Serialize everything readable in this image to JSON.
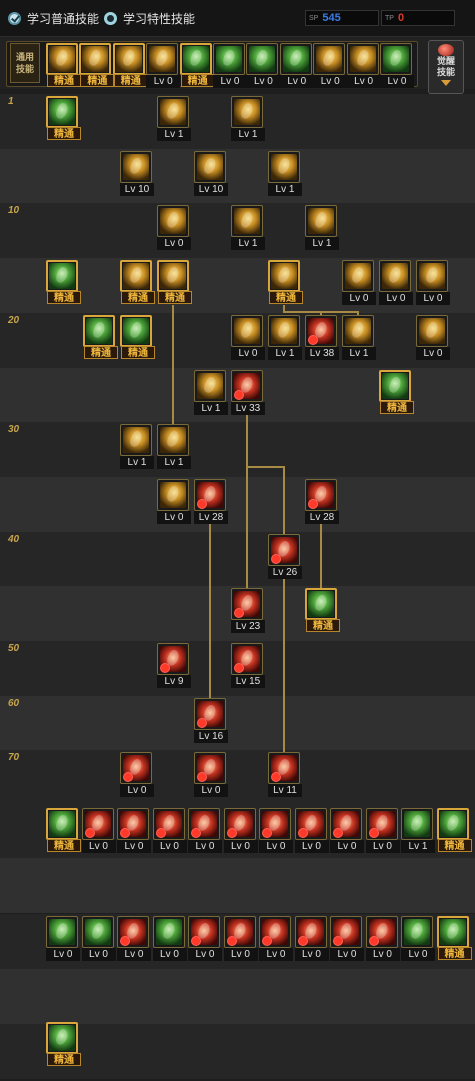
{
  "tabs": [
    {
      "label": "学习普通技能",
      "selected": true
    },
    {
      "label": "学习特性技能",
      "selected": false
    }
  ],
  "sp_blue": {
    "label": "SP",
    "value": "545"
  },
  "sp_red": {
    "label": "TP",
    "value": "0"
  },
  "hotbar": {
    "generic_label_1": "通用",
    "generic_label_2": "技能",
    "awaken_label_1": "觉醒",
    "awaken_label_2": "技能",
    "slots": [
      {
        "tone": "y",
        "label": "精通"
      },
      {
        "tone": "y",
        "label": "精通"
      },
      {
        "tone": "y",
        "label": "精通"
      },
      {
        "tone": "y",
        "label": "Lv 0"
      },
      {
        "tone": "g",
        "label": "精通"
      },
      {
        "tone": "g",
        "label": "Lv 0"
      },
      {
        "tone": "g",
        "label": "Lv 0"
      },
      {
        "tone": "g",
        "label": "Lv 0"
      },
      {
        "tone": "y",
        "label": "Lv 0"
      },
      {
        "tone": "y",
        "label": "Lv 0"
      },
      {
        "tone": "g",
        "label": "Lv 0"
      }
    ]
  },
  "level_markers": [
    "1",
    "10",
    "20",
    "30",
    "40",
    "50",
    "60",
    "70"
  ],
  "tree_skills": [
    {
      "row": 0,
      "col": 0,
      "tone": "g",
      "label": "精通"
    },
    {
      "row": 0,
      "col": 3,
      "tone": "y",
      "label": "Lv 1"
    },
    {
      "row": 0,
      "col": 5,
      "tone": "y",
      "label": "Lv 1"
    },
    {
      "row": 1,
      "col": 2,
      "tone": "y",
      "label": "Lv 10"
    },
    {
      "row": 1,
      "col": 4,
      "tone": "y",
      "label": "Lv 10"
    },
    {
      "row": 1,
      "col": 6,
      "tone": "y",
      "label": "Lv 1"
    },
    {
      "row": 2,
      "col": 3,
      "tone": "y",
      "label": "Lv 0"
    },
    {
      "row": 2,
      "col": 5,
      "tone": "y",
      "label": "Lv 1"
    },
    {
      "row": 2,
      "col": 7,
      "tone": "y",
      "label": "Lv 1"
    },
    {
      "row": 3,
      "col": 0,
      "tone": "g",
      "label": "精通"
    },
    {
      "row": 3,
      "col": 2,
      "tone": "y",
      "label": "精通"
    },
    {
      "row": 3,
      "col": 3,
      "tone": "y",
      "label": "精通"
    },
    {
      "row": 3,
      "col": 6,
      "tone": "y",
      "label": "精通"
    },
    {
      "row": 3,
      "col": 8,
      "tone": "y",
      "label": "Lv 0"
    },
    {
      "row": 3,
      "col": 9,
      "tone": "y",
      "label": "Lv 0"
    },
    {
      "row": 3,
      "col": 10,
      "tone": "y",
      "label": "Lv 0"
    },
    {
      "row": 4,
      "col": 1,
      "tone": "g",
      "label": "精通"
    },
    {
      "row": 4,
      "col": 2,
      "tone": "g",
      "label": "精通"
    },
    {
      "row": 4,
      "col": 5,
      "tone": "y",
      "label": "Lv 0"
    },
    {
      "row": 4,
      "col": 6,
      "tone": "y",
      "label": "Lv 1"
    },
    {
      "row": 4,
      "col": 7,
      "tone": "r",
      "label": "Lv 38"
    },
    {
      "row": 4,
      "col": 8,
      "tone": "y",
      "label": "Lv 1"
    },
    {
      "row": 4,
      "col": 10,
      "tone": "y",
      "label": "Lv 0"
    },
    {
      "row": 5,
      "col": 4,
      "tone": "y",
      "label": "Lv 1"
    },
    {
      "row": 5,
      "col": 5,
      "tone": "r",
      "label": "Lv 33"
    },
    {
      "row": 5,
      "col": 9,
      "tone": "g",
      "label": "精通"
    },
    {
      "row": 6,
      "col": 2,
      "tone": "y",
      "label": "Lv 1"
    },
    {
      "row": 6,
      "col": 3,
      "tone": "y",
      "label": "Lv 1"
    },
    {
      "row": 7,
      "col": 3,
      "tone": "y",
      "label": "Lv 0"
    },
    {
      "row": 7,
      "col": 4,
      "tone": "r",
      "label": "Lv 28"
    },
    {
      "row": 7,
      "col": 7,
      "tone": "r",
      "label": "Lv 28"
    },
    {
      "row": 8,
      "col": 6,
      "tone": "r",
      "label": "Lv 26"
    },
    {
      "row": 9,
      "col": 5,
      "tone": "r",
      "label": "Lv 23"
    },
    {
      "row": 9,
      "col": 7,
      "tone": "g",
      "label": "精通"
    },
    {
      "row": 10,
      "col": 3,
      "tone": "r",
      "label": "Lv 9"
    },
    {
      "row": 10,
      "col": 5,
      "tone": "r",
      "label": "Lv 15"
    },
    {
      "row": 11,
      "col": 4,
      "tone": "r",
      "label": "Lv 16"
    },
    {
      "row": 12,
      "col": 2,
      "tone": "r",
      "label": "Lv 0"
    },
    {
      "row": 12,
      "col": 4,
      "tone": "r",
      "label": "Lv 0"
    },
    {
      "row": 12,
      "col": 6,
      "tone": "r",
      "label": "Lv 11"
    }
  ],
  "passive_row_1": [
    {
      "tone": "g",
      "label": "精通"
    },
    {
      "tone": "r",
      "label": "Lv 0"
    },
    {
      "tone": "r",
      "label": "Lv 0"
    },
    {
      "tone": "r",
      "label": "Lv 0"
    },
    {
      "tone": "r",
      "label": "Lv 0"
    },
    {
      "tone": "r",
      "label": "Lv 0"
    },
    {
      "tone": "r",
      "label": "Lv 0"
    },
    {
      "tone": "r",
      "label": "Lv 0"
    },
    {
      "tone": "r",
      "label": "Lv 0"
    },
    {
      "tone": "r",
      "label": "Lv 0"
    },
    {
      "tone": "g",
      "label": "Lv 1"
    },
    {
      "tone": "g",
      "label": "精通"
    }
  ],
  "passive_row_2": [
    {
      "tone": "g",
      "label": "Lv 0"
    },
    {
      "tone": "g",
      "label": "Lv 0"
    },
    {
      "tone": "r",
      "label": "Lv 0"
    },
    {
      "tone": "g",
      "label": "Lv 0"
    },
    {
      "tone": "r",
      "label": "Lv 0"
    },
    {
      "tone": "r",
      "label": "Lv 0"
    },
    {
      "tone": "r",
      "label": "Lv 0"
    },
    {
      "tone": "r",
      "label": "Lv 0"
    },
    {
      "tone": "r",
      "label": "Lv 0"
    },
    {
      "tone": "r",
      "label": "Lv 0"
    },
    {
      "tone": "g",
      "label": "Lv 0"
    },
    {
      "tone": "g",
      "label": "精通"
    }
  ],
  "passive_row_3": [
    {
      "tone": "g",
      "label": "精通"
    }
  ]
}
